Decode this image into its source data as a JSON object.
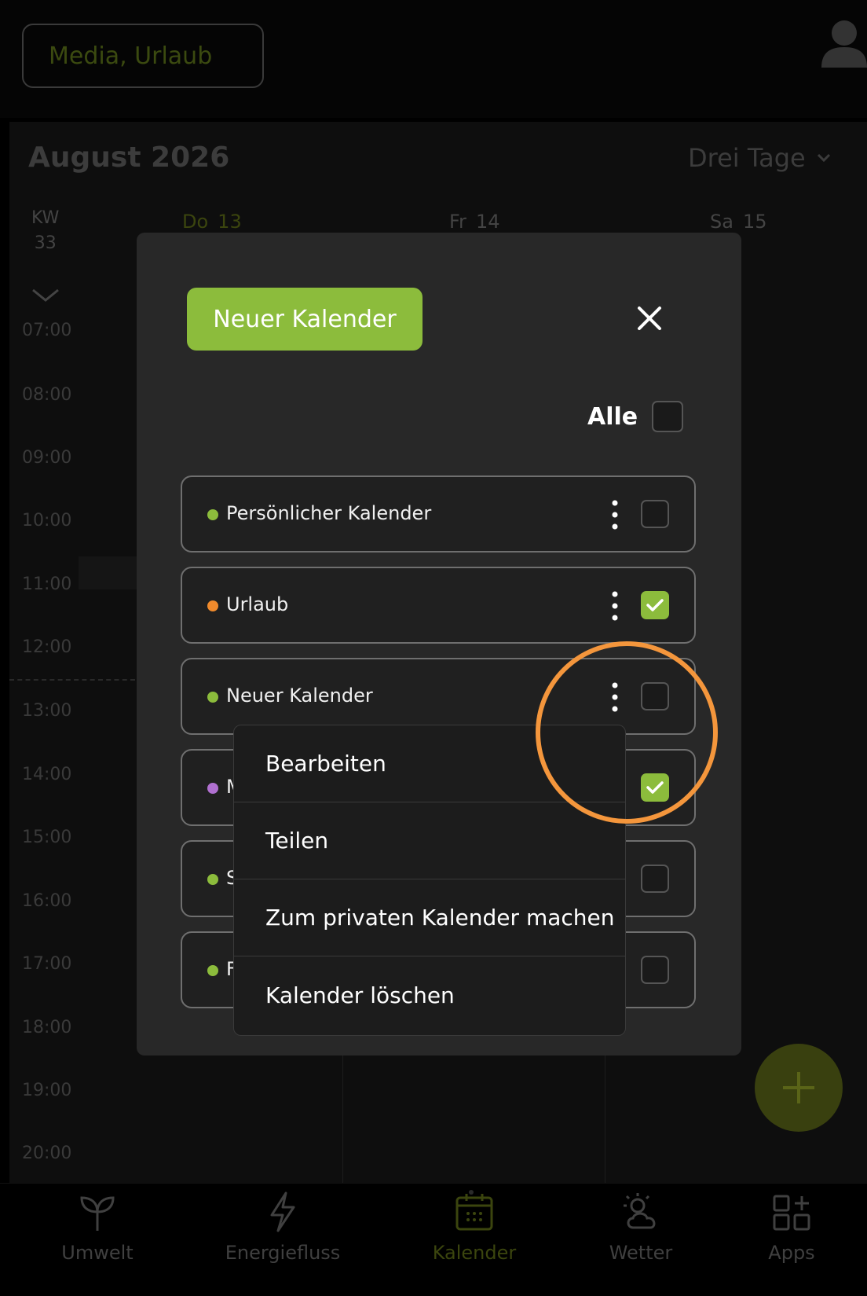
{
  "header": {
    "filter_label": "Media, Urlaub"
  },
  "calendar": {
    "month_title": "August 2026",
    "view_mode": "Drei Tage",
    "week_label": "KW",
    "week_number": "33",
    "days": [
      {
        "name": "Do",
        "num": "13",
        "color": "#3b450e"
      },
      {
        "name": "Fr",
        "num": "14",
        "color": "#444"
      },
      {
        "name": "Sa",
        "num": "15",
        "color": "#444"
      }
    ],
    "hours": [
      "07:00",
      "08:00",
      "09:00",
      "10:00",
      "11:00",
      "12:00",
      "13:00",
      "14:00",
      "15:00",
      "16:00",
      "17:00",
      "18:00",
      "19:00",
      "20:00"
    ]
  },
  "modal": {
    "new_calendar_label": "Neuer Kalender",
    "all_label": "Alle",
    "all_checked": false,
    "calendars": [
      {
        "name": "Persönlicher Kalender",
        "color": "#8cbc3c",
        "checked": false
      },
      {
        "name": "Urlaub",
        "color": "#f08a2c",
        "checked": true
      },
      {
        "name": "Neuer Kalender",
        "color": "#8cbc3c",
        "checked": false
      },
      {
        "name": "M",
        "color": "#b070d0",
        "checked": true
      },
      {
        "name": "S",
        "color": "#8cbc3c",
        "checked": false
      },
      {
        "name": "F",
        "color": "#8cbc3c",
        "checked": false
      }
    ]
  },
  "context_menu": {
    "items": [
      "Bearbeiten",
      "Teilen",
      "Zum privaten Kalender machen",
      "Kalender löschen"
    ]
  },
  "bottom_nav": {
    "items": [
      {
        "label": "Umwelt",
        "icon": "sprout-icon"
      },
      {
        "label": "Energiefluss",
        "icon": "lightning-icon"
      },
      {
        "label": "Kalender",
        "icon": "calendar-icon",
        "active": true
      },
      {
        "label": "Wetter",
        "icon": "weather-icon"
      },
      {
        "label": "Apps",
        "icon": "apps-grid-icon"
      }
    ]
  },
  "colors": {
    "accent_green": "#8cbc3c",
    "highlight_orange": "#f4963c"
  }
}
